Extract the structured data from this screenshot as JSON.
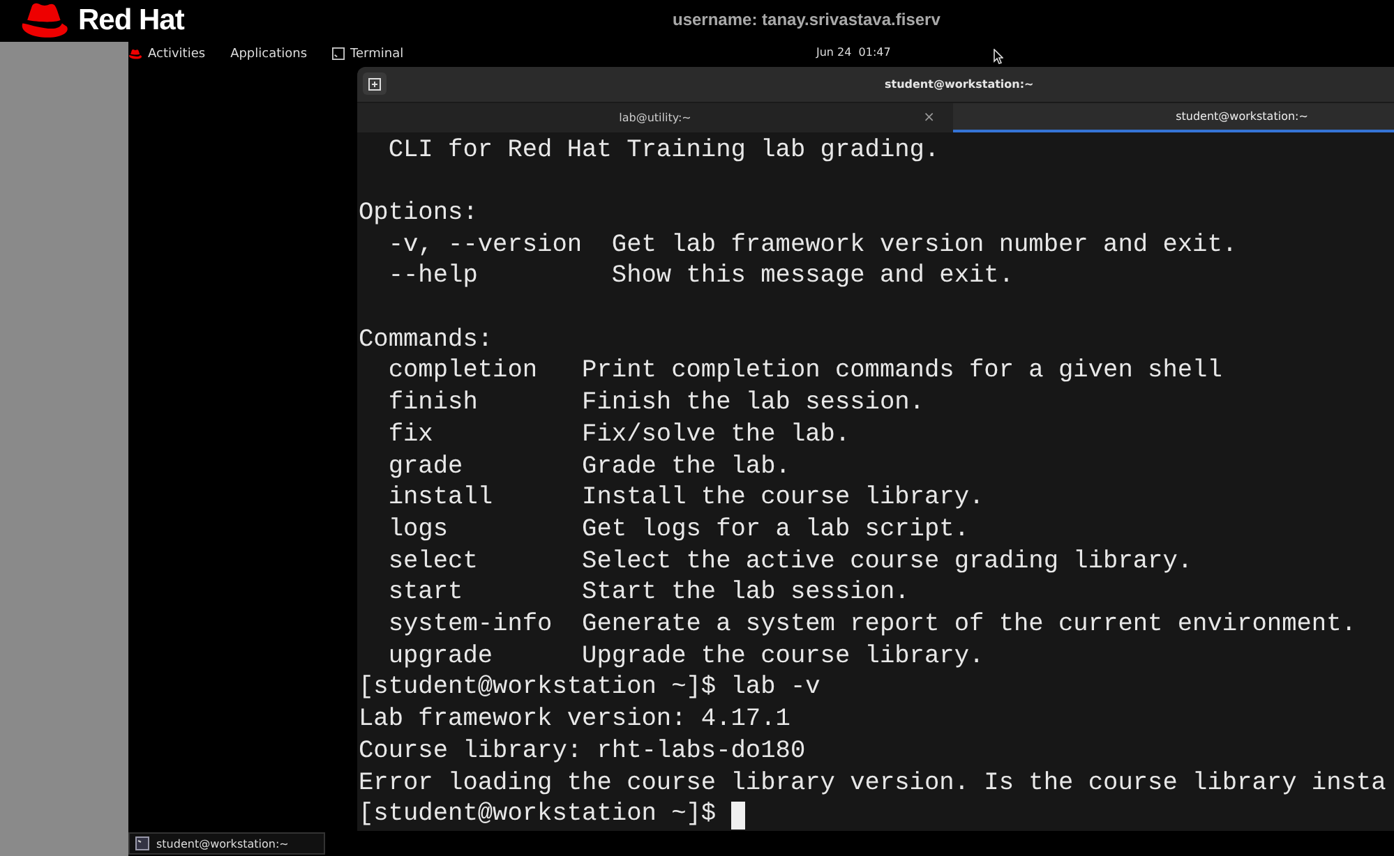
{
  "brand": {
    "name": "Red Hat"
  },
  "session": {
    "username": "username: tanay.srivastava.fiserv"
  },
  "top_bar": {
    "menu": [
      {
        "label": "Activities",
        "kind": "activities"
      },
      {
        "label": "Applications",
        "kind": "plain"
      },
      {
        "label": "Terminal",
        "kind": "app"
      }
    ],
    "clock": "Jun 24  01:47"
  },
  "terminal": {
    "title": "student@workstation:~",
    "tabs": [
      {
        "label": "lab@utility:~",
        "selected": false,
        "close": "×"
      },
      {
        "label": "student@workstation:~",
        "selected": true
      }
    ],
    "blocks": [
      [
        "  CLI for Red Hat Training lab grading."
      ],
      [
        "Options:",
        "  -v, --version  Get lab framework version number and exit.",
        "  --help         Show this message and exit."
      ],
      [
        "Commands:",
        "  completion   Print completion commands for a given shell",
        "  finish       Finish the lab session.",
        "  fix          Fix/solve the lab.",
        "  grade        Grade the lab.",
        "  install      Install the course library.",
        "  logs         Get logs for a lab script.",
        "  select       Select the active course grading library.",
        "  start        Start the lab session.",
        "  system-info  Generate a system report of the current environment.",
        "  upgrade      Upgrade the course library.",
        "[student@workstation ~]$ lab -v",
        "Lab framework version: 4.17.1",
        "Course library: rht-labs-do180",
        "Error loading the course library version. Is the course library insta"
      ]
    ],
    "input_line": {
      "prompt": "[student@workstation ~]$",
      "cursor": true
    }
  },
  "taskbar": {
    "items": [
      {
        "label": "student@workstation:~"
      }
    ]
  }
}
